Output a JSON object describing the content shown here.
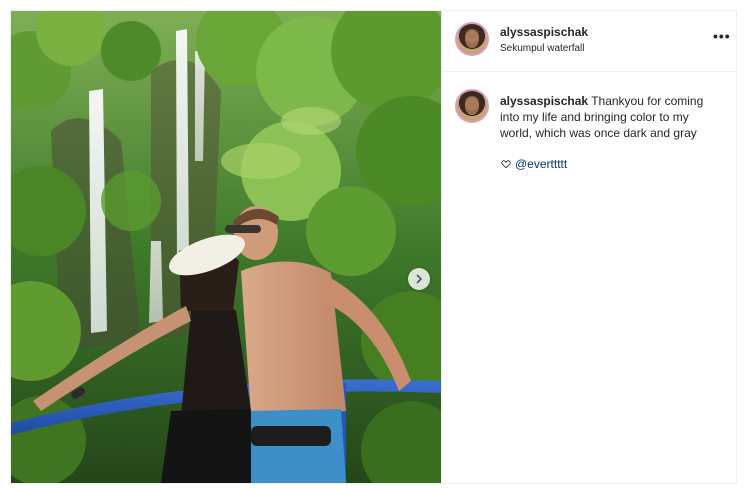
{
  "post": {
    "username": "alyssaspischak",
    "location": "Sekumpul waterfall",
    "more_glyph": "•••",
    "caption_user": "alyssaspischak",
    "caption_text": "Thankyou for coming into my life and bringing color to my world, which was once dark and gray",
    "mention": "@everttttt"
  },
  "icons": {
    "options": "more-options-icon",
    "next": "chevron-right-icon",
    "like": "heart-icon"
  },
  "colors": {
    "mention": "#00376b",
    "avatar_ring": "#d6a1b6",
    "text": "#262626"
  }
}
